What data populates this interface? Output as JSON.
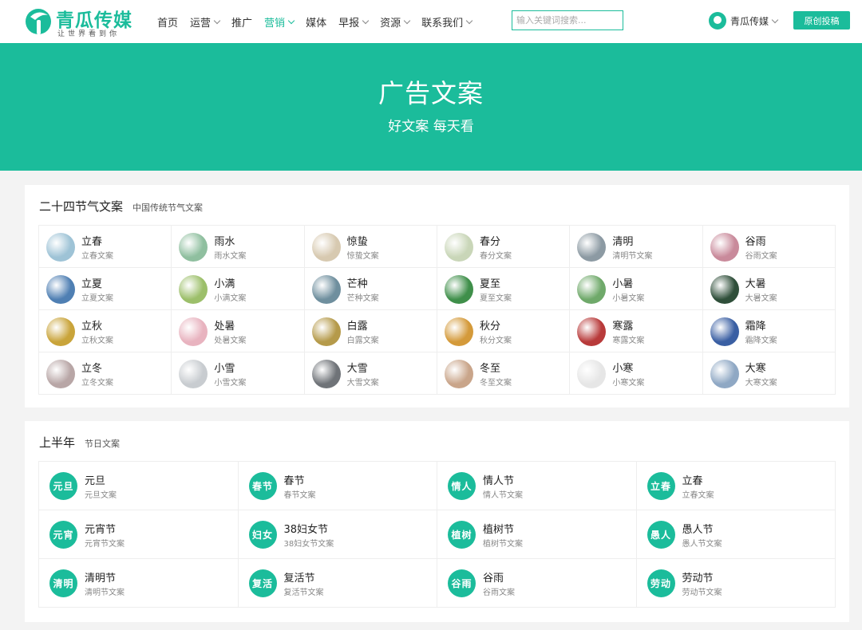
{
  "header": {
    "logo_title": "青瓜传媒",
    "logo_slogan": "让世界看到你",
    "nav": [
      {
        "label": "首页",
        "dropdown": false,
        "active": false
      },
      {
        "label": "运营",
        "dropdown": true,
        "active": false
      },
      {
        "label": "推广",
        "dropdown": false,
        "active": false
      },
      {
        "label": "营销",
        "dropdown": true,
        "active": true
      },
      {
        "label": "媒体",
        "dropdown": false,
        "active": false
      },
      {
        "label": "早报",
        "dropdown": true,
        "active": false
      },
      {
        "label": "资源",
        "dropdown": true,
        "active": false
      },
      {
        "label": "联系我们",
        "dropdown": true,
        "active": false
      }
    ],
    "search_placeholder": "输入关键词搜索...",
    "user_name": "青瓜传媒",
    "submit_label": "原创投稿"
  },
  "banner": {
    "title": "广告文案",
    "subtitle": "好文案 每天看"
  },
  "solar_terms": {
    "title": "二十四节气文案",
    "subtitle": "中国传统节气文案",
    "items": [
      {
        "name": "立春",
        "desc": "立春文案",
        "color": "#9ec3d6"
      },
      {
        "name": "雨水",
        "desc": "雨水文案",
        "color": "#8fbf9f"
      },
      {
        "name": "惊蛰",
        "desc": "惊蛰文案",
        "color": "#d7c9b0"
      },
      {
        "name": "春分",
        "desc": "春分文案",
        "color": "#c9d6b8"
      },
      {
        "name": "清明",
        "desc": "清明节文案",
        "color": "#8c9aa3"
      },
      {
        "name": "谷雨",
        "desc": "谷雨文案",
        "color": "#c98a9b"
      },
      {
        "name": "立夏",
        "desc": "立夏文案",
        "color": "#4f7fb3"
      },
      {
        "name": "小满",
        "desc": "小满文案",
        "color": "#9cbf6a"
      },
      {
        "name": "芒种",
        "desc": "芒种文案",
        "color": "#6f8f9e"
      },
      {
        "name": "夏至",
        "desc": "夏至文案",
        "color": "#3f8f4a"
      },
      {
        "name": "小暑",
        "desc": "小暑文案",
        "color": "#6fa96a"
      },
      {
        "name": "大暑",
        "desc": "大暑文案",
        "color": "#2f4f3a"
      },
      {
        "name": "立秋",
        "desc": "立秋文案",
        "color": "#c9a43a"
      },
      {
        "name": "处暑",
        "desc": "处暑文案",
        "color": "#e8b3bf"
      },
      {
        "name": "白露",
        "desc": "白露文案",
        "color": "#b59a4a"
      },
      {
        "name": "秋分",
        "desc": "秋分文案",
        "color": "#d49a3a"
      },
      {
        "name": "寒露",
        "desc": "寒露文案",
        "color": "#b83a3a"
      },
      {
        "name": "霜降",
        "desc": "霜降文案",
        "color": "#3a5fa3"
      },
      {
        "name": "立冬",
        "desc": "立冬文案",
        "color": "#b8a6a6"
      },
      {
        "name": "小雪",
        "desc": "小雪文案",
        "color": "#c8ccd0"
      },
      {
        "name": "大雪",
        "desc": "大雪文案",
        "color": "#6f7378"
      },
      {
        "name": "冬至",
        "desc": "冬至文案",
        "color": "#c9a58a"
      },
      {
        "name": "小寒",
        "desc": "小寒文案",
        "color": "#e6e6e6"
      },
      {
        "name": "大寒",
        "desc": "大寒文案",
        "color": "#8fa8c4"
      }
    ]
  },
  "holidays": {
    "title": "上半年",
    "subtitle": "节日文案",
    "items": [
      {
        "icon_text": "元旦",
        "name": "元旦",
        "desc": "元旦文案"
      },
      {
        "icon_text": "春节",
        "name": "春节",
        "desc": "春节文案"
      },
      {
        "icon_text": "情人",
        "name": "情人节",
        "desc": "情人节文案"
      },
      {
        "icon_text": "立春",
        "name": "立春",
        "desc": "立春文案"
      },
      {
        "icon_text": "元宵",
        "name": "元宵节",
        "desc": "元宵节文案"
      },
      {
        "icon_text": "妇女",
        "name": "38妇女节",
        "desc": "38妇女节文案"
      },
      {
        "icon_text": "植树",
        "name": "植树节",
        "desc": "植树节文案"
      },
      {
        "icon_text": "愚人",
        "name": "愚人节",
        "desc": "愚人节文案"
      },
      {
        "icon_text": "清明",
        "name": "清明节",
        "desc": "清明节文案"
      },
      {
        "icon_text": "复活",
        "name": "复活节",
        "desc": "复活节文案"
      },
      {
        "icon_text": "谷雨",
        "name": "谷雨",
        "desc": "谷雨文案"
      },
      {
        "icon_text": "劳动",
        "name": "劳动节",
        "desc": "劳动节文案"
      }
    ]
  },
  "colors": {
    "accent": "#1bbc9b"
  }
}
